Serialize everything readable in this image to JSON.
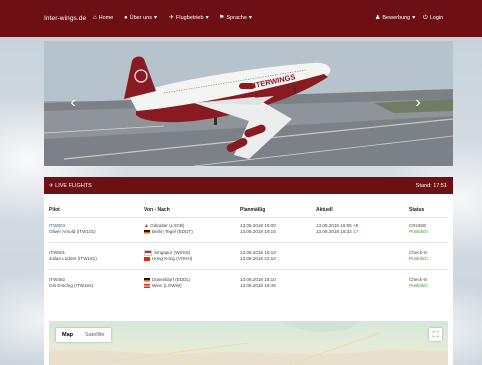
{
  "navbar": {
    "brand": "Inter-wings.de",
    "items": [
      {
        "label": "Home",
        "icon": "home-icon"
      },
      {
        "label": "Über uns",
        "icon": "info-icon"
      },
      {
        "label": "Flugbetrieb",
        "icon": "plane-icon"
      },
      {
        "label": "Sprache",
        "icon": "language-icon"
      }
    ],
    "right_items": [
      {
        "label": "Bewerbung",
        "icon": "user-icon"
      },
      {
        "label": "Login",
        "icon": "login-icon"
      }
    ]
  },
  "carousel": {
    "prev_glyph": "‹",
    "next_glyph": "›",
    "aircraft_text": "INTERWINGS"
  },
  "live_flights": {
    "title": "LIVE FLIGHTS",
    "stand": "Stand: 17:51",
    "columns": [
      "Pilot",
      "Von - Nach",
      "Planmäßig",
      "Aktuell",
      "Status"
    ],
    "rows": [
      {
        "flight": "ITW803",
        "pilot": "Oliver Arnold (ITW101)",
        "from": "Gibraltar (LXGB)",
        "to": "Berlin Tegel (EDDT)",
        "planned_dep": "13.08.2018 16:00",
        "planned_arr": "13.08.2018 19:15",
        "actual_dep": "13.08.2018 16:05",
        "actual_dep_delay": "+5",
        "actual_arr": "13.08.2018 19:32",
        "actual_arr_delay": "17",
        "status": "CRUISE",
        "status_detail": "Pünktlich"
      },
      {
        "flight": "ITW601",
        "pilot": "Julian Lüders (ITW161)",
        "from": "Singapur (WSSS)",
        "to": "Hong Kong (VHHH)",
        "planned_dep": "13.08.2018 18:10",
        "planned_arr": "13.08.2018 22:10",
        "actual_dep": "",
        "actual_arr": "",
        "status": "Check-In",
        "status_detail": "Pünktlich"
      },
      {
        "flight": "ITW482",
        "pilot": "Olo Erschig (ITW164)",
        "from": "Düsseldorf (EDDL)",
        "to": "Wien (LOWW)",
        "planned_dep": "13.08.2018 18:10",
        "planned_arr": "13.08.2018 19:45",
        "actual_dep": "",
        "actual_arr": "",
        "status": "Check-In",
        "status_detail": "Pünktlich"
      }
    ]
  },
  "map": {
    "tabs": [
      "Map",
      "Satellite"
    ],
    "fullscreen_glyph": "⛶"
  },
  "colors": {
    "brand": "#6e0f14",
    "link": "#2e6da4",
    "ok": "#2d9a2d"
  }
}
